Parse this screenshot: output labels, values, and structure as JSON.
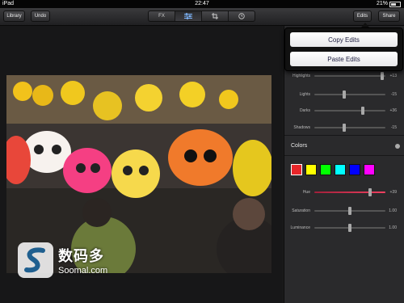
{
  "status": {
    "carrier": "iPad",
    "time": "22:47",
    "battery": "21%"
  },
  "toolbar": {
    "library": "Library",
    "undo": "Undo",
    "fx": "FX",
    "edits": "Edits",
    "share": "Share"
  },
  "popover": {
    "copy": "Copy Edits",
    "paste": "Paste Edits"
  },
  "exposure": [
    {
      "label": "Highlights",
      "value": "+13",
      "level": 0.95
    },
    {
      "label": "Lights",
      "value": "-15",
      "level": 0.42
    },
    {
      "label": "Darks",
      "value": "+36",
      "level": 0.68
    },
    {
      "label": "Shadows",
      "value": "-15",
      "level": 0.42
    }
  ],
  "colors": {
    "title": "Colors",
    "swatches": [
      "#e8262a",
      "#ffff00",
      "#00ff00",
      "#00ffff",
      "#0000ff",
      "#ff00ff"
    ],
    "sliders": [
      {
        "label": "Hue",
        "value": "+39",
        "level": 0.78,
        "active": true
      },
      {
        "label": "Saturation",
        "value": "1.00",
        "level": 0.5
      },
      {
        "label": "Luminance",
        "value": "1.00",
        "level": 0.5
      }
    ]
  },
  "watermark": {
    "cn": "数码多",
    "en": "Soomal.com"
  }
}
